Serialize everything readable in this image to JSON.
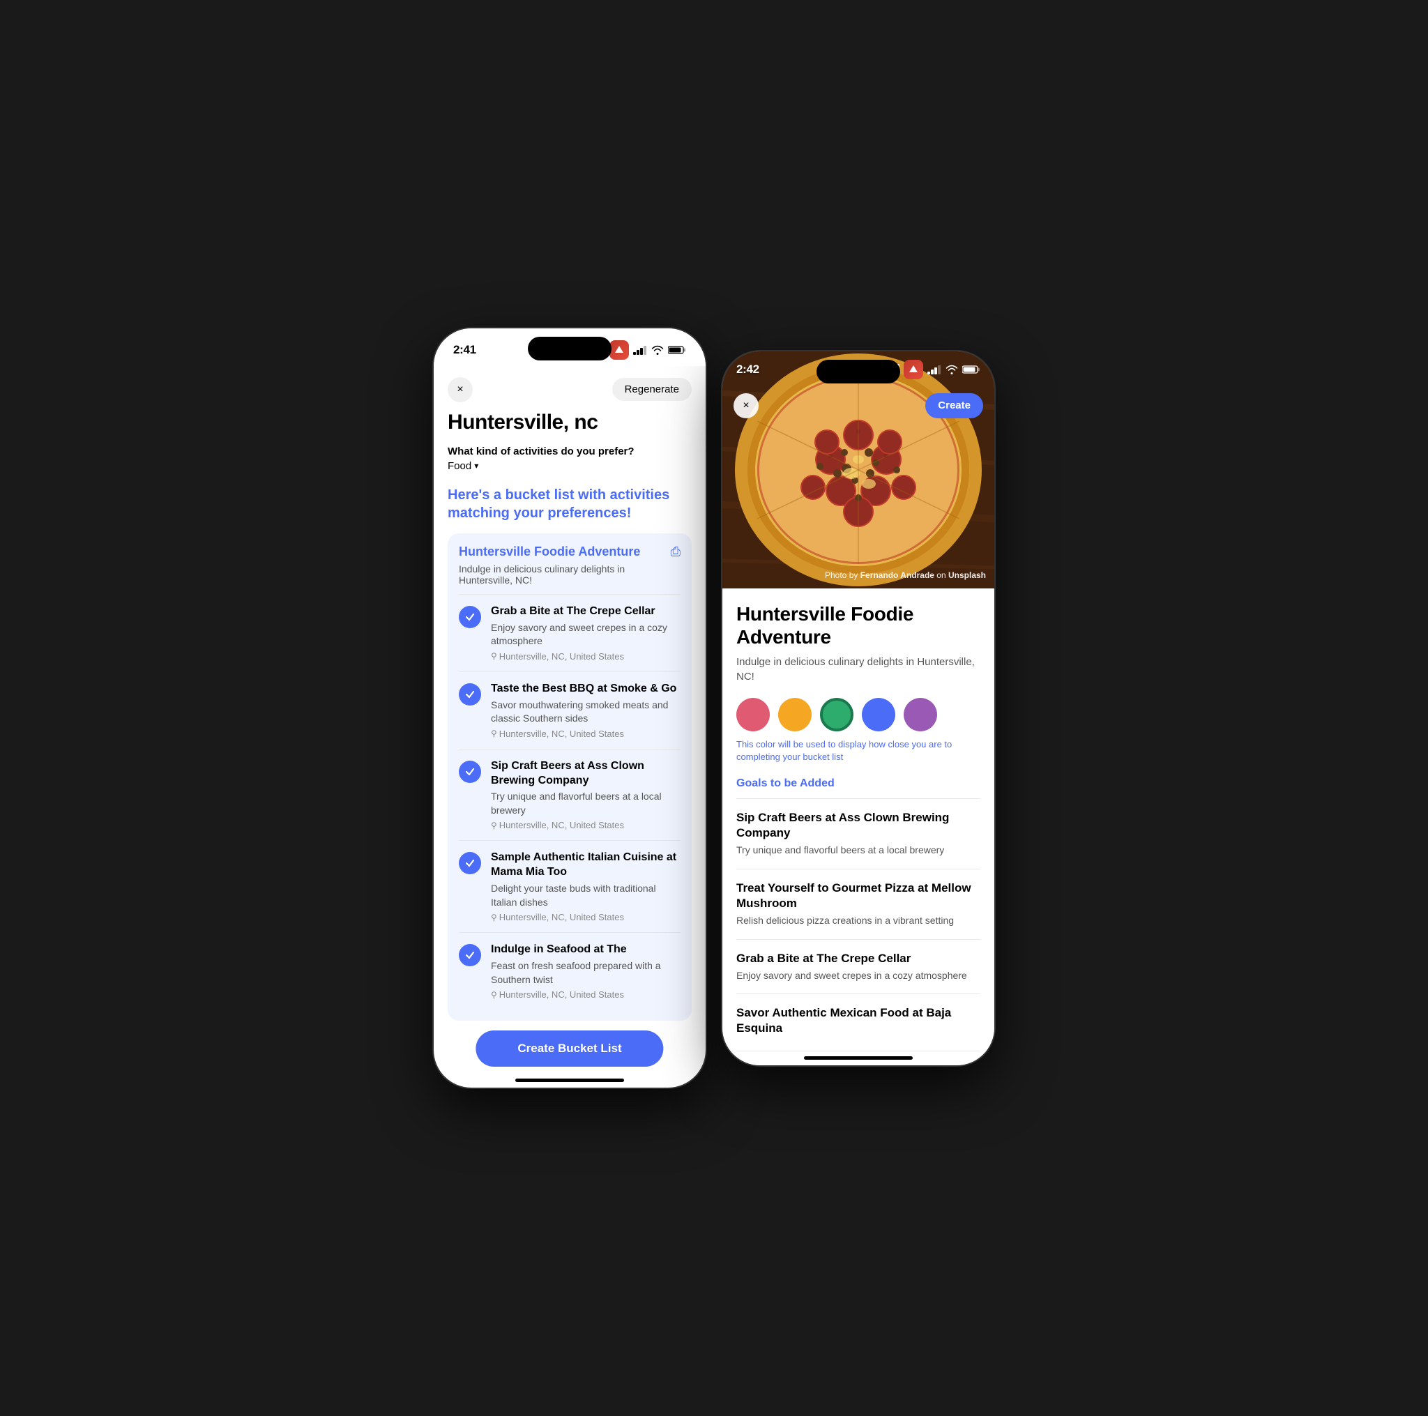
{
  "left_phone": {
    "status": {
      "time": "2:41",
      "bookmark_icon": "bookmark",
      "signal_icon": "signal",
      "wifi_icon": "wifi",
      "battery_icon": "battery"
    },
    "modal": {
      "close_label": "×",
      "regenerate_label": "Regenerate",
      "location": "Huntersville, nc",
      "question_label": "What kind of activities do you prefer?",
      "food_value": "Food",
      "bucket_list_prompt": "Here's a bucket list with activities matching your preferences!",
      "bucket_card": {
        "title": "Huntersville Foodie Adventure",
        "share_icon": "share",
        "description": "Indulge in delicious culinary delights in Huntersville, NC!"
      },
      "activities": [
        {
          "title": "Grab a Bite at The Crepe Cellar",
          "description": "Enjoy savory and sweet crepes in a cozy atmosphere",
          "location": "Huntersville, NC, United States"
        },
        {
          "title": "Taste the Best BBQ at Smoke & Go",
          "description": "Savor mouthwatering smoked meats and classic Southern sides",
          "location": "Huntersville, NC, United States"
        },
        {
          "title": "Sip Craft Beers at Ass Clown Brewing Company",
          "description": "Try unique and flavorful beers at a local brewery",
          "location": "Huntersville, NC, United States"
        },
        {
          "title": "Sample Authentic Italian Cuisine at Mama Mia Too",
          "description": "Delight your taste buds with traditional Italian dishes",
          "location": "Huntersville, NC, United States"
        },
        {
          "title": "Indulge in Seafood at The",
          "description": "Feast on fresh seafood prepared with a Southern twist",
          "location": "Huntersville, NC, United States"
        }
      ],
      "create_button": "Create Bucket List"
    }
  },
  "right_phone": {
    "status": {
      "time": "2:42",
      "bookmark_icon": "bookmark",
      "signal_icon": "signal",
      "wifi_icon": "wifi",
      "battery_icon": "battery"
    },
    "photo_credit": "Photo by",
    "photo_credit_author": "Fernando Andrade",
    "photo_credit_platform": "Unsplash",
    "close_label": "×",
    "create_label": "Create",
    "detail": {
      "title": "Huntersville Foodie Adventure",
      "description": "Indulge in delicious culinary delights in Huntersville, NC!",
      "color_hint": "This color will be used to display how close you are to completing your bucket list",
      "colors": [
        {
          "name": "pink",
          "hex": "#e05a72",
          "selected": false
        },
        {
          "name": "orange",
          "hex": "#f5a623",
          "selected": false
        },
        {
          "name": "green",
          "hex": "#2eac6e",
          "selected": true
        },
        {
          "name": "blue",
          "hex": "#4a6cf7",
          "selected": false
        },
        {
          "name": "purple",
          "hex": "#9b59b6",
          "selected": false
        }
      ],
      "goals_title": "Goals to be Added",
      "goals": [
        {
          "title": "Sip Craft Beers at Ass Clown Brewing Company",
          "description": "Try unique and flavorful beers at a local brewery"
        },
        {
          "title": "Treat Yourself to Gourmet Pizza at Mellow Mushroom",
          "description": "Relish delicious pizza creations in a vibrant setting"
        },
        {
          "title": "Grab a Bite at The Crepe Cellar",
          "description": "Enjoy savory and sweet crepes in a cozy atmosphere"
        },
        {
          "title": "Savor Authentic Mexican Food at Baja Esquina",
          "description": ""
        }
      ]
    }
  }
}
